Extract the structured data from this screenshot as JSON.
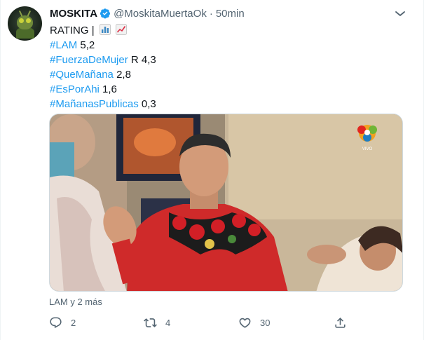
{
  "author": {
    "name": "MOSKITA",
    "handle": "@MoskitaMuertaOk",
    "separator": "·",
    "time": "50min"
  },
  "tweet": {
    "rating_label": "RATING |",
    "lines": [
      {
        "tag": "#LAM",
        "value": " 5,2"
      },
      {
        "tag": "#FuerzaDeMujer",
        "value": " R 4,3"
      },
      {
        "tag": "#QueMañana",
        "value": " 2,8"
      },
      {
        "tag": "#EsPorAhi",
        "value": " 1,6"
      },
      {
        "tag": "#MañanasPublicas",
        "value": " 0,3"
      }
    ]
  },
  "media": {
    "live_label": "VIVO"
  },
  "caption": "LAM y 2 más",
  "actions": {
    "replies": "2",
    "retweets": "4",
    "likes": "30"
  },
  "colors": {
    "link": "#1d9bf0",
    "muted": "#536471",
    "verified": "#1d9bf0"
  },
  "icons": {
    "verified": "verified-badge-icon",
    "more": "more-icon",
    "reply": "reply-icon",
    "retweet": "retweet-icon",
    "like": "like-icon",
    "share": "share-icon",
    "bar_chart_emoji": "bar-chart-emoji-icon",
    "trend_up_emoji": "chart-increasing-emoji-icon"
  }
}
